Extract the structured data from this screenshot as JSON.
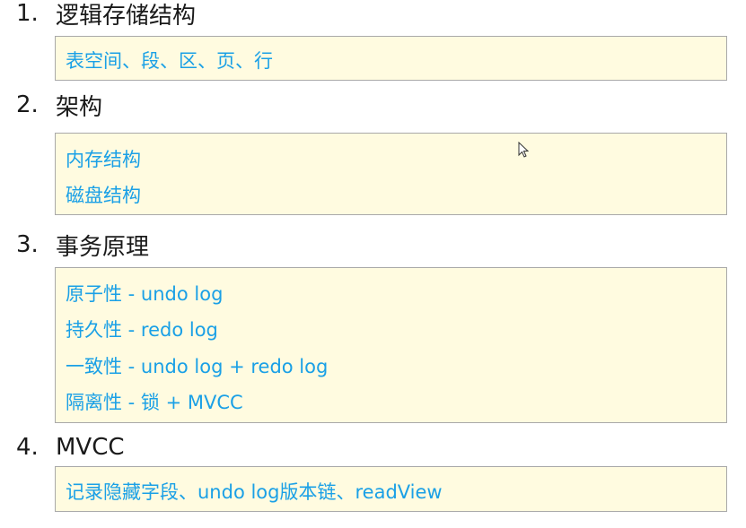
{
  "sections": [
    {
      "number": "1.",
      "title": "逻辑存储结构",
      "items": [
        "表空间、段、区、页、行"
      ]
    },
    {
      "number": "2.",
      "title": "架构",
      "items": [
        "内存结构",
        "磁盘结构"
      ]
    },
    {
      "number": "3.",
      "title": "事务原理",
      "items": [
        "原子性 - undo log",
        "持久性 - redo log",
        "一致性 - undo log + redo log",
        "隔离性 - 锁 + MVCC"
      ]
    },
    {
      "number": "4.",
      "title": "MVCC",
      "items": [
        "记录隐藏字段、undo log版本链、readView"
      ]
    }
  ],
  "colors": {
    "heading": "#1a1a1a",
    "item_text": "#1aa0e6",
    "box_background": "#fffbe0",
    "box_border": "#a9a9a9"
  },
  "icons": {
    "cursor": "mouse-pointer-icon"
  }
}
